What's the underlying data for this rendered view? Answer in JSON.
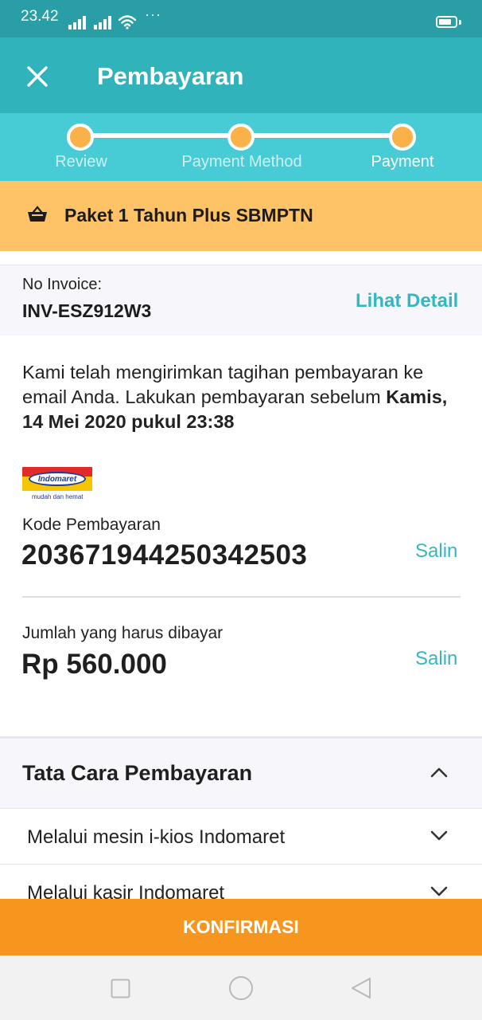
{
  "status_bar": {
    "time": "23.42",
    "dots": "···"
  },
  "app_bar": {
    "title": "Pembayaran",
    "close_icon": "close-icon"
  },
  "stepper": {
    "steps": [
      {
        "label": "Review"
      },
      {
        "label": "Payment Method"
      },
      {
        "label": "Payment"
      }
    ],
    "active_step": 3
  },
  "package": {
    "name": "Paket 1 Tahun Plus SBMPTN",
    "icon": "basket-icon"
  },
  "invoice": {
    "label": "No Invoice:",
    "number": "INV-ESZ912W3",
    "detail_link": "Lihat Detail"
  },
  "message": {
    "text": "Kami telah mengirimkan tagihan pembayaran ke email Anda. Lakukan pembayaran sebelum",
    "deadline": "Kamis, 14 Mei 2020 pukul 23:38"
  },
  "merchant": {
    "logo_text": "Indomaret",
    "tagline": "mudah dan hemat"
  },
  "payment_code": {
    "label": "Kode Pembayaran",
    "value": "2036719442503425​03",
    "copy": "Salin"
  },
  "amount": {
    "label": "Jumlah yang harus dibayar",
    "value": "Rp 560.000",
    "copy": "Salin"
  },
  "instructions": {
    "title": "Tata Cara Pembayaran",
    "items": [
      {
        "label": "Melalui mesin i-kios Indomaret"
      },
      {
        "label": "Melalui kasir Indomaret"
      }
    ]
  },
  "confirm_button": {
    "label": "KONFIRMASI"
  },
  "colors": {
    "primary_teal": "#31b3bc",
    "stepper_teal": "#47ccd6",
    "accent_orange": "#f7961e",
    "banner_yellow": "#fec267",
    "link_teal": "#36b6c0"
  }
}
